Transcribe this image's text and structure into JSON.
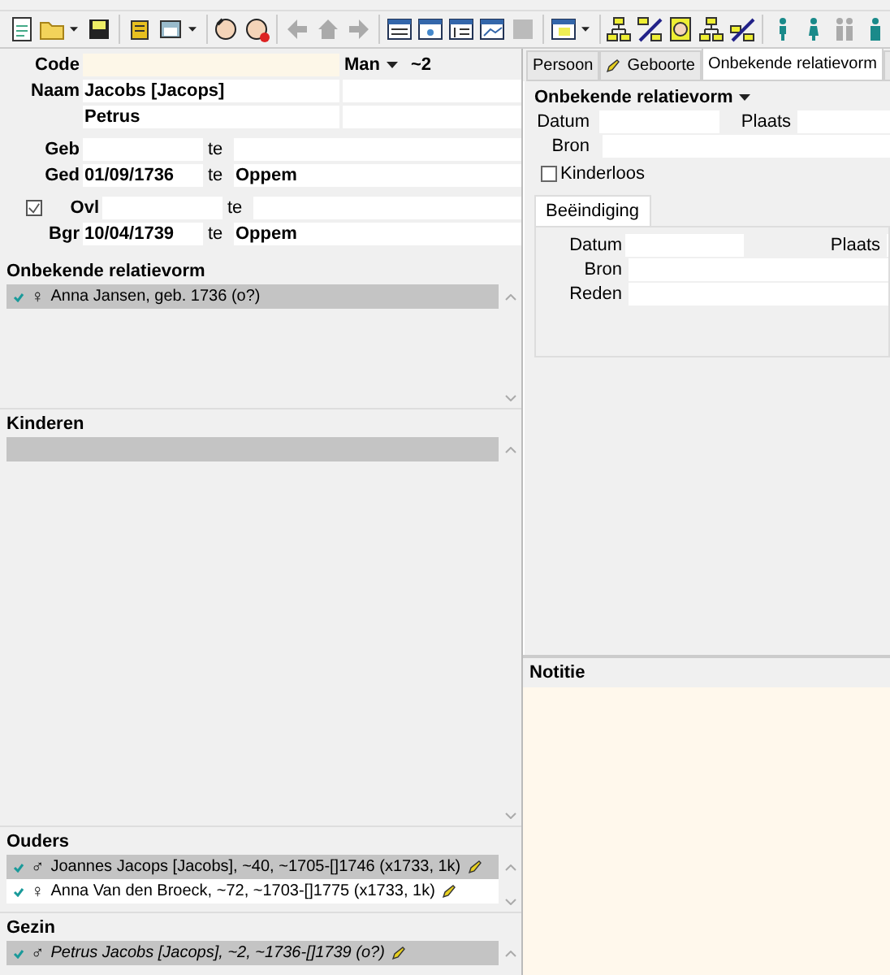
{
  "person": {
    "code_label": "Code",
    "gender": "Man",
    "number": "~2",
    "names": [
      {
        "label": "Naam",
        "value": "Jacobs [Jacops]"
      },
      {
        "value": "Petrus"
      }
    ],
    "events": [
      {
        "label": "Geb",
        "te": "te",
        "kind": "plain"
      },
      {
        "label": "Ged",
        "date": "01/09/1736",
        "te": "te",
        "place": "Oppem",
        "kind": "plain"
      },
      {
        "label": "Ovl",
        "te": "te",
        "kind": "checkbox",
        "checked": true
      },
      {
        "label": "Bgr",
        "date": "10/04/1739",
        "te": "te",
        "place": "Oppem",
        "kind": "plain"
      }
    ]
  },
  "sections": [
    {
      "title": "Onbekende relatievorm",
      "rows": [
        {
          "check": true,
          "sex": "♀",
          "text": "Anna Jansen, geb. 1736 (o?)",
          "selected": true,
          "italic": false,
          "edited": false
        }
      ]
    },
    {
      "title": "Kinderen"
    },
    {
      "title": "Ouders",
      "rows": [
        {
          "check": true,
          "sex": "♂",
          "text": "Joannes Jacops [Jacobs], ~40, ~1705-[]1746 (x1733, 1k)",
          "selected": true,
          "italic": false,
          "edited": true
        },
        {
          "check": true,
          "sex": "♀",
          "text": "Anna Van den Broeck, ~72, ~1703-[]1775 (x1733, 1k)",
          "selected": false,
          "italic": false,
          "edited": true
        }
      ]
    },
    {
      "title": "Gezin",
      "rows": [
        {
          "check": true,
          "sex": "♂",
          "text": "Petrus Jacobs [Jacops], ~2, ~1736-[]1739 (o?)",
          "selected": true,
          "italic": true,
          "edited": true
        }
      ]
    }
  ],
  "tabs": [
    {
      "label": "Persoon",
      "selected": false,
      "edited": false
    },
    {
      "label": "Geboorte",
      "selected": false,
      "edited": true
    },
    {
      "label": "Onbekende relatievorm",
      "selected": true,
      "edited": false
    }
  ],
  "relation": {
    "type": "Onbekende relatievorm",
    "datum_label": "Datum",
    "plaats_label": "Plaats",
    "bron_label": "Bron",
    "kinderloos": {
      "label": "Kinderloos",
      "checked": false
    }
  },
  "ending": {
    "tab": "Beëindiging",
    "datum_label": "Datum",
    "plaats_label": "Plaats",
    "bron_label": "Bron",
    "reden_label": "Reden"
  },
  "notes": {
    "title": "Notitie"
  }
}
